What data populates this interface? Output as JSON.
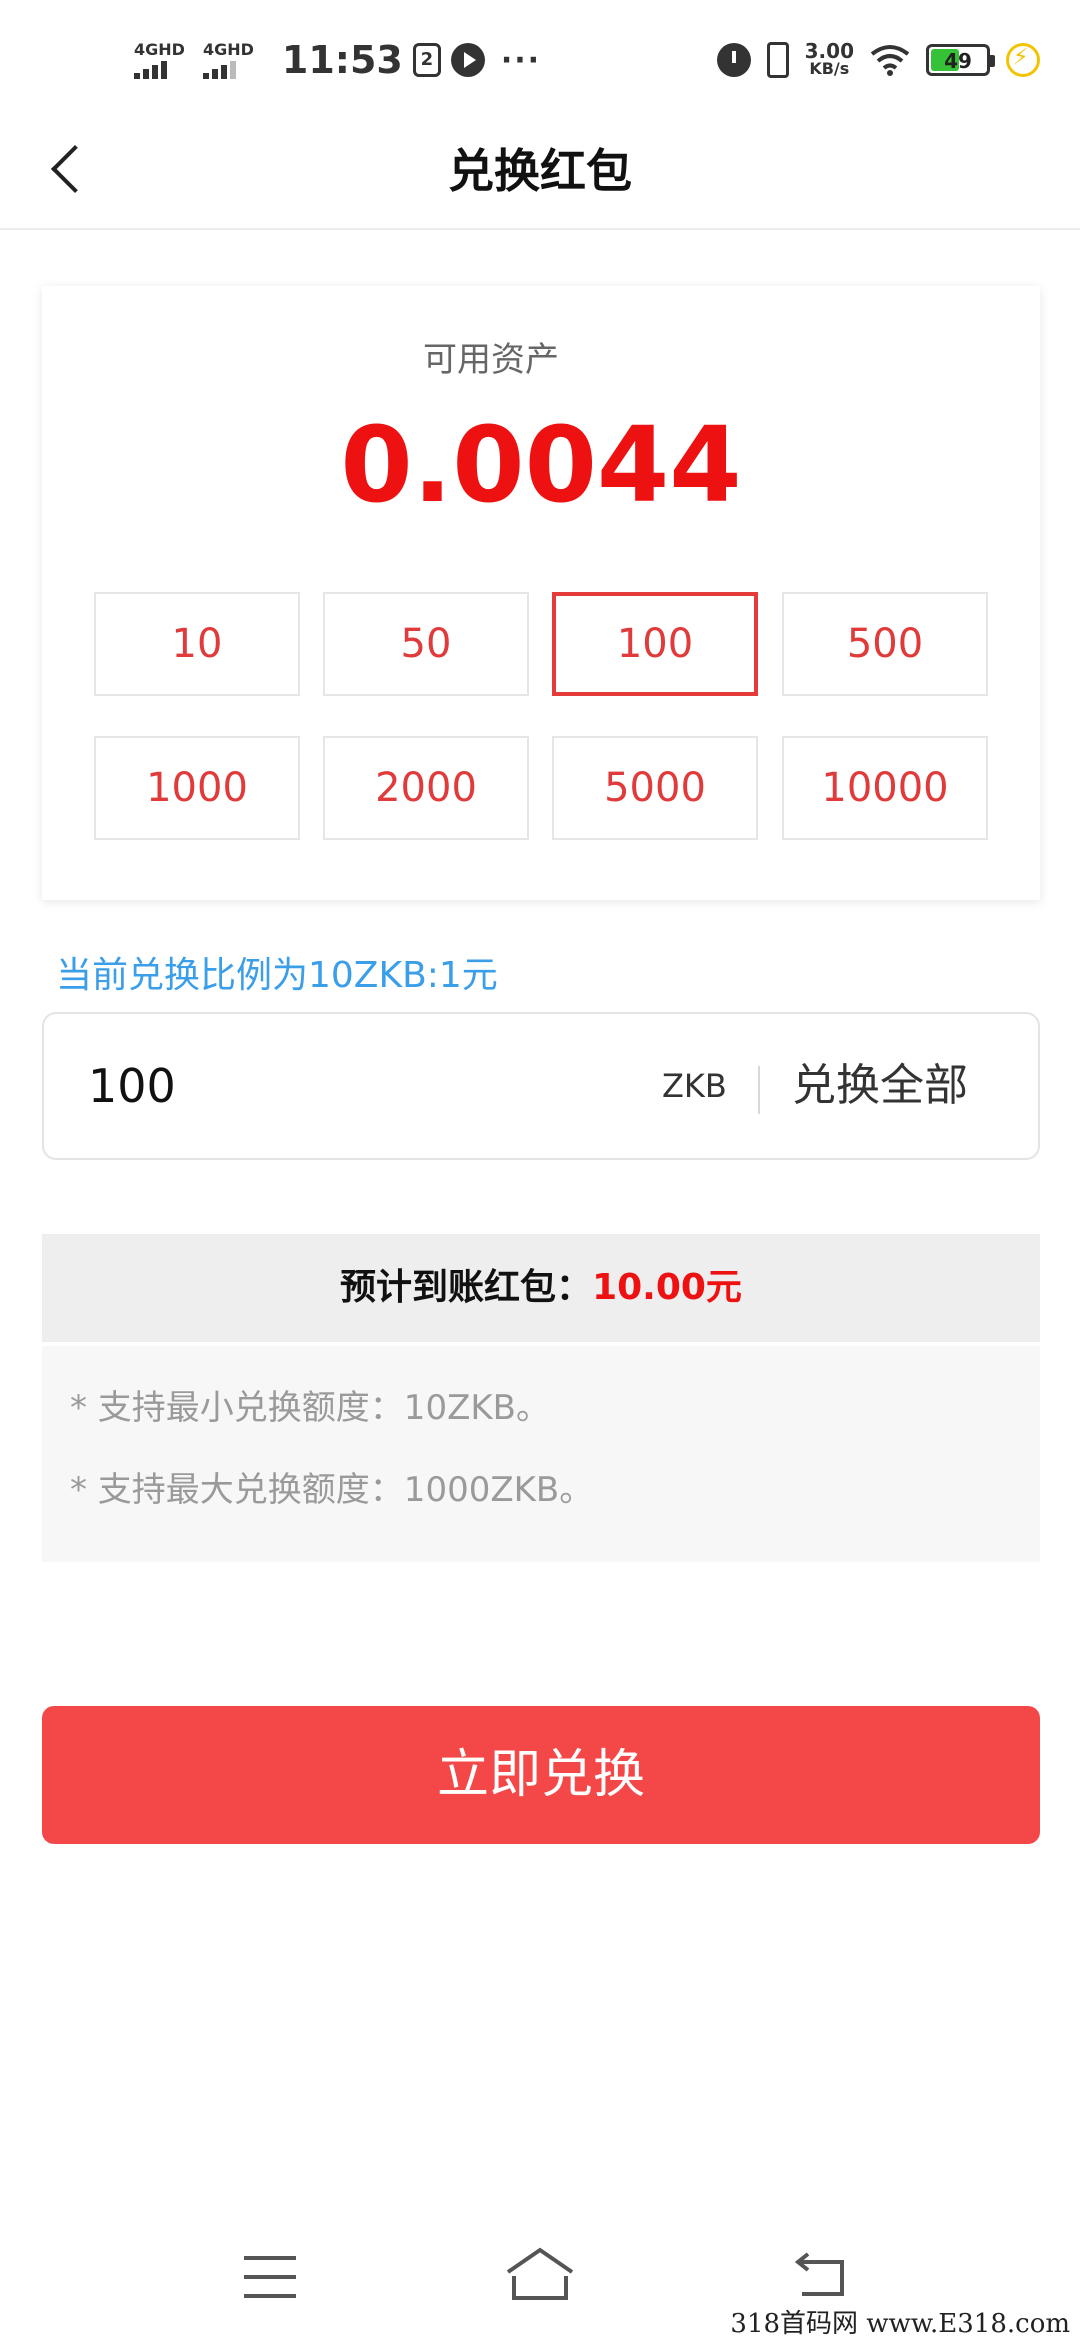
{
  "status_bar": {
    "network1": "4GHD",
    "network2": "4GHD",
    "time": "11:53",
    "notif_box": "2",
    "more": "···",
    "speed_value": "3.00",
    "speed_unit": "KB/s",
    "battery": "49",
    "icons": [
      "signal-icon",
      "signal-icon",
      "sim-icon",
      "play-icon",
      "alarm-icon",
      "vibrate-icon",
      "wifi-icon",
      "battery-icon",
      "charging-icon"
    ]
  },
  "header": {
    "title": "兑换红包",
    "back_icon": "chevron-left-icon"
  },
  "assets": {
    "label": "可用资产",
    "value": "0.0044"
  },
  "options": [
    "10",
    "50",
    "100",
    "500",
    "1000",
    "2000",
    "5000",
    "10000"
  ],
  "selected_option": "100",
  "rate_text": "当前兑换比例为10ZKB:1元",
  "input": {
    "value": "100",
    "unit": "ZKB",
    "exchange_all": "兑换全部"
  },
  "estimate": {
    "label": "预计到账红包：",
    "amount": "10.00元"
  },
  "notes": [
    "* 支持最小兑换额度：10ZKB。",
    "* 支持最大兑换额度：1000ZKB。"
  ],
  "submit_label": "立即兑换",
  "bottom_nav": [
    "menu-icon",
    "home-icon",
    "back-icon"
  ],
  "watermark": "318首码网 www.E318.com",
  "colors": {
    "accent_red": "#ee1111",
    "button_red": "#f44848",
    "rate_blue": "#3b9ee8"
  }
}
